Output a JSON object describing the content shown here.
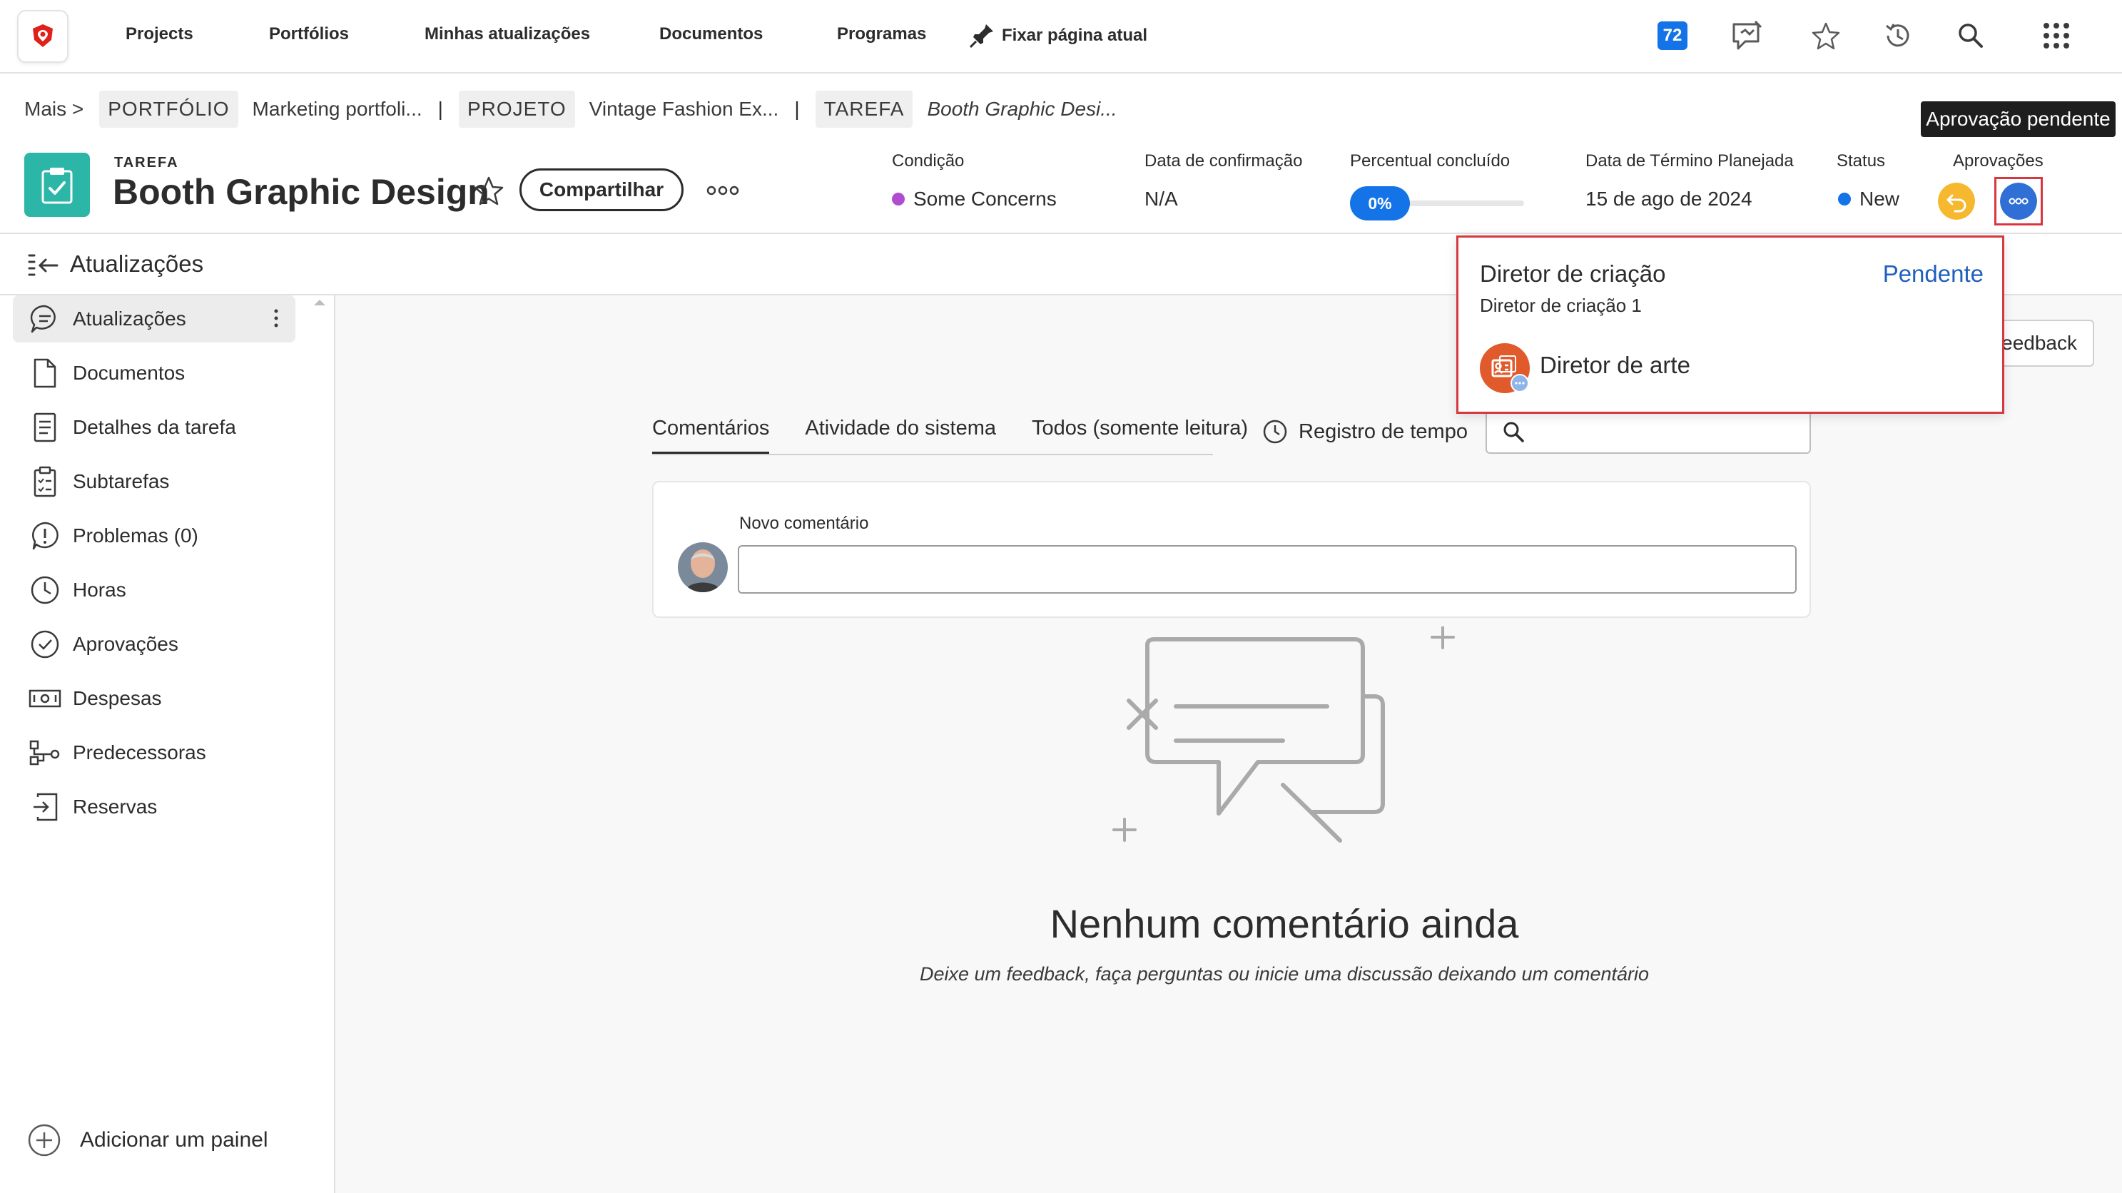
{
  "nav": {
    "links": [
      "Projects",
      "Portfólios",
      "Minhas atualizações",
      "Documentos",
      "Programas"
    ],
    "pin_label": "Fixar página atual",
    "notification_count": "72",
    "icons": [
      "apps-logo-icon",
      "pin-icon",
      "notifications-icon",
      "feedback-chat-icon",
      "star-icon",
      "history-icon",
      "search-icon",
      "app-grid-icon"
    ]
  },
  "breadcrumb": {
    "more": "Mais >",
    "portfolio_tag": "PORTFÓLIO",
    "portfolio_name": "Marketing portfoli...",
    "project_tag": "PROJETO",
    "project_name": "Vintage Fashion Ex...",
    "task_tag": "TAREFA",
    "task_name": "Booth Graphic Desi...",
    "separator": "|"
  },
  "tooltip": "Aprovação pendente",
  "header": {
    "kind": "TAREFA",
    "title": "Booth Graphic Design",
    "share_label": "Compartilhar",
    "fields": {
      "condition_label": "Condição",
      "condition_value": "Some Concerns",
      "condition_color": "#b04dcf",
      "commit_label": "Data de confirmação",
      "commit_value": "N/A",
      "percent_label": "Percentual concluído",
      "percent_value": "0%",
      "percent_fraction": 0,
      "due_label": "Data de Término Planejada",
      "due_value": "15 de ago de 2024",
      "status_label": "Status",
      "status_value": "New",
      "status_color": "#1473e6",
      "approvals_label": "Aprovações"
    }
  },
  "updates_bar": {
    "label": "Atualizações"
  },
  "sidebar": {
    "items": [
      {
        "label": "Atualizações",
        "icon": "chat-bubble-icon"
      },
      {
        "label": "Documentos",
        "icon": "document-icon"
      },
      {
        "label": "Detalhes da tarefa",
        "icon": "details-icon"
      },
      {
        "label": "Subtarefas",
        "icon": "subtasks-icon"
      },
      {
        "label": "Problemas (0)",
        "icon": "issue-icon"
      },
      {
        "label": "Horas",
        "icon": "clock-icon"
      },
      {
        "label": "Aprovações",
        "icon": "checkmark-circle-icon"
      },
      {
        "label": "Despesas",
        "icon": "money-icon"
      },
      {
        "label": "Predecessoras",
        "icon": "predecessor-icon"
      },
      {
        "label": "Reservas",
        "icon": "booking-icon"
      }
    ],
    "add_panel": "Adicionar um painel"
  },
  "main": {
    "tabs": [
      "Comentários",
      "Atividade do sistema",
      "Todos (somente leitura)"
    ],
    "time_log": "Registro de tempo",
    "search_placeholder": "",
    "feedback_label": "Feedback",
    "new_comment_label": "Novo comentário",
    "empty_title": "Nenhum comentário ainda",
    "empty_subtitle": "Deixe um feedback, faça perguntas ou inicie uma discussão deixando um comentário"
  },
  "popover": {
    "title": "Diretor de criação",
    "status": "Pendente",
    "subtitle": "Diretor de criação 1",
    "person": "Diretor de arte"
  }
}
